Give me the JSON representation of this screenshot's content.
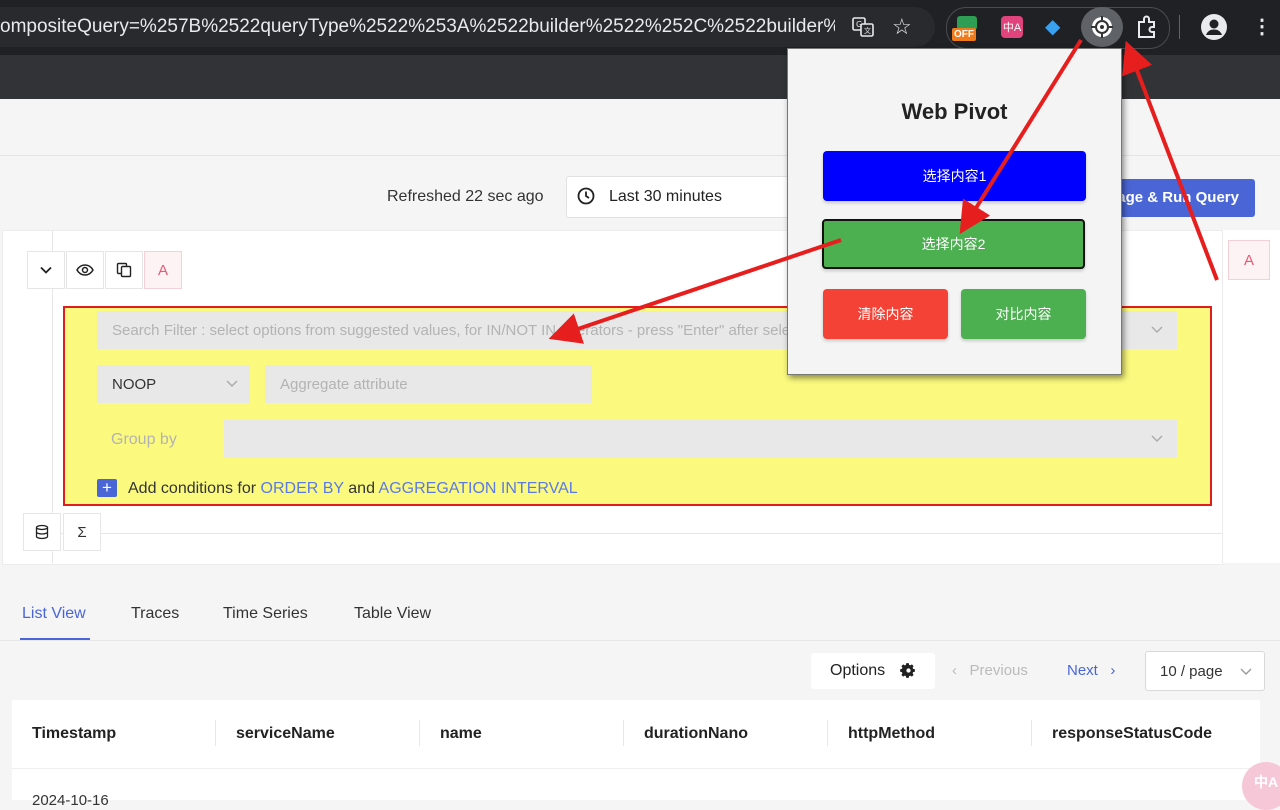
{
  "browser": {
    "url": "ompositeQuery=%257B%2522queryType%2522%253A%2522builder%2522%252C%2522builder%...",
    "ext_off_badge": "OFF"
  },
  "header": {
    "refreshed_text": "Refreshed 22 sec ago",
    "time_range": "Last 30 minutes",
    "run_query_label": "Stage & Run Query"
  },
  "query": {
    "query_letter": "A",
    "right_letter": "A",
    "search_placeholder": "Search Filter : select options from suggested values, for IN/NOT IN operators - press \"Enter\" after selecting options",
    "aggregate_operator": "NOOP",
    "aggregate_attribute_placeholder": "Aggregate attribute",
    "group_by_label": "Group by",
    "add_conditions_prefix": "Add conditions for",
    "order_by": "ORDER BY",
    "and": "and",
    "aggregation_interval": "AGGREGATION INTERVAL",
    "sigma_symbol": "Σ"
  },
  "tabs": [
    {
      "label": "List View",
      "active": true
    },
    {
      "label": "Traces",
      "active": false
    },
    {
      "label": "Time Series",
      "active": false
    },
    {
      "label": "Table View",
      "active": false
    }
  ],
  "pagination": {
    "options_label": "Options",
    "previous_label": "Previous",
    "next_label": "Next",
    "page_size": "10 / page"
  },
  "table": {
    "columns": [
      "Timestamp",
      "serviceName",
      "name",
      "durationNano",
      "httpMethod",
      "responseStatusCode"
    ],
    "first_row_timestamp": "2024-10-16"
  },
  "popup": {
    "title": "Web Pivot",
    "select1": "选择内容1",
    "select2": "选择内容2",
    "clear": "清除内容",
    "compare": "对比内容"
  },
  "translate_fab": "中A",
  "colors": {
    "accent": "#4a66d6",
    "builder_bg": "#fbfa7e",
    "highlight_border": "#e01c1c",
    "popup_blue": "#0000ff",
    "popup_green": "#4caf50",
    "popup_red": "#f44336"
  }
}
